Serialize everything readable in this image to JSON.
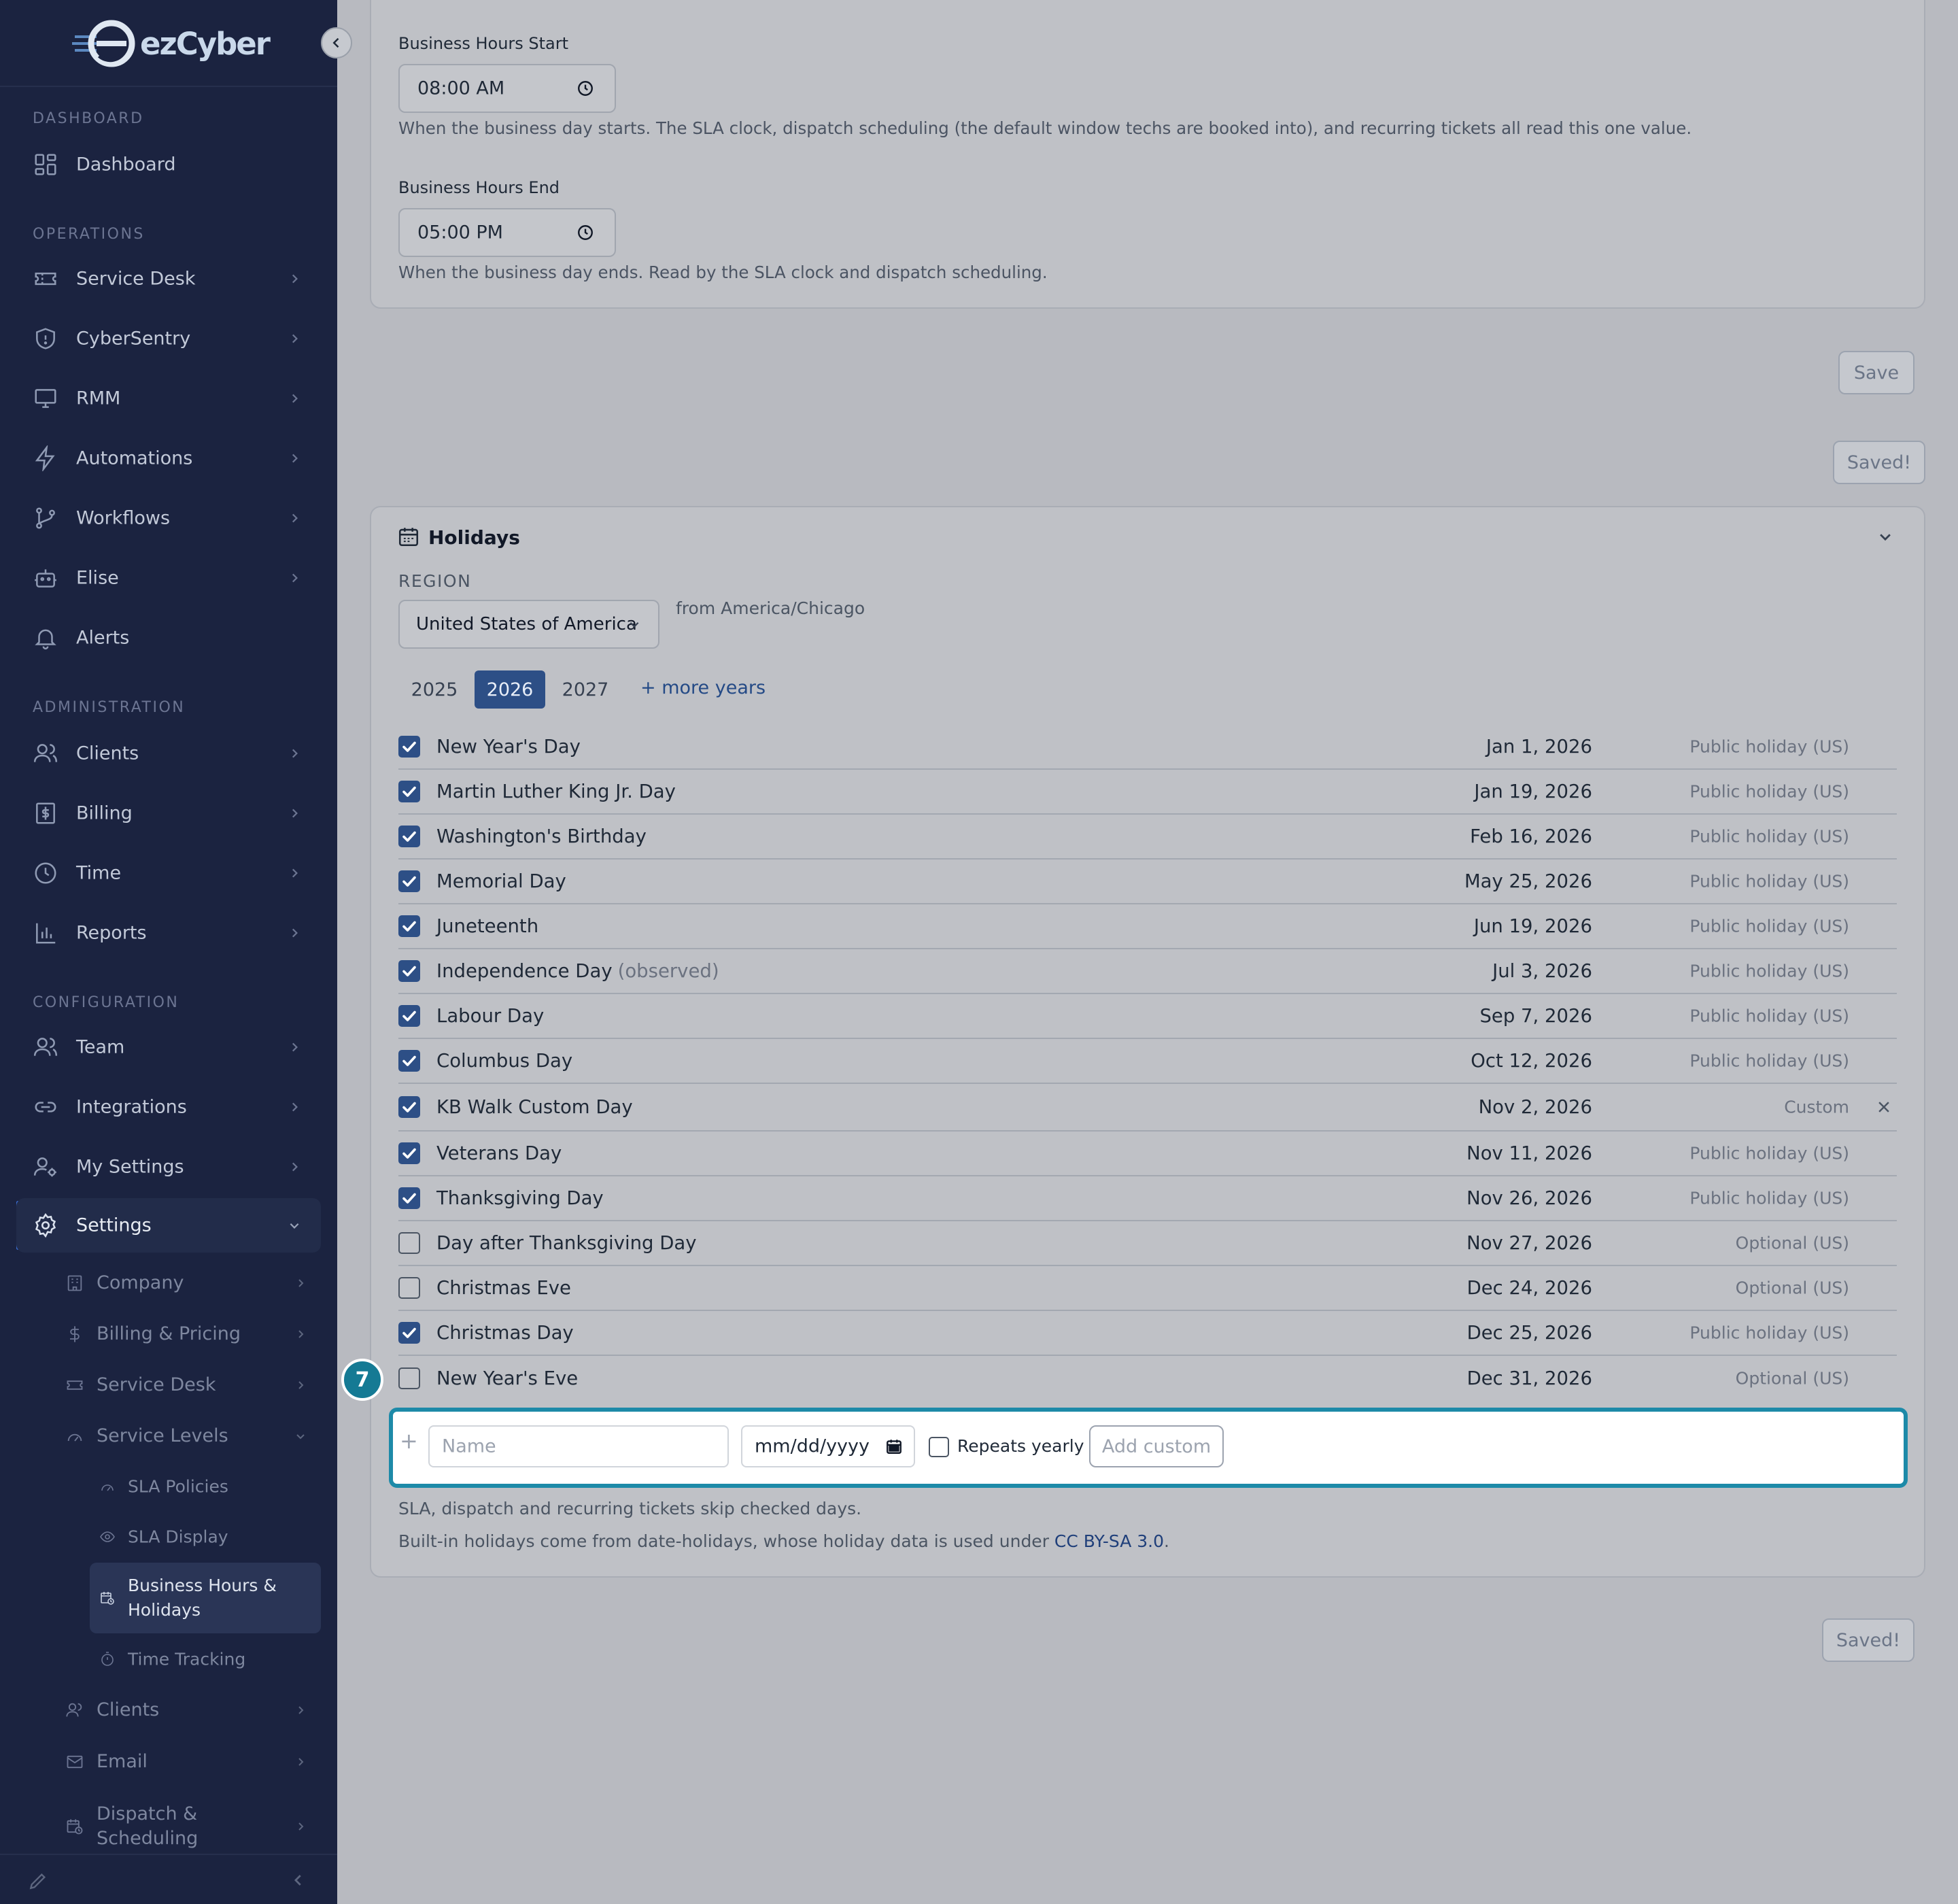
{
  "brand": {
    "name": "ezCyber"
  },
  "sidebar": {
    "sections": {
      "dashboard": "DASHBOARD",
      "operations": "OPERATIONS",
      "administration": "ADMINISTRATION",
      "configuration": "CONFIGURATION"
    },
    "items": {
      "dashboard": "Dashboard",
      "service_desk": "Service Desk",
      "cybersentry": "CyberSentry",
      "rmm": "RMM",
      "automations": "Automations",
      "workflows": "Workflows",
      "elise": "Elise",
      "alerts": "Alerts",
      "clients": "Clients",
      "billing": "Billing",
      "time": "Time",
      "reports": "Reports",
      "team": "Team",
      "integrations": "Integrations",
      "my_settings": "My Settings",
      "settings": "Settings"
    },
    "settings_sub": {
      "company": "Company",
      "billing_pricing": "Billing & Pricing",
      "service_desk": "Service Desk",
      "service_levels": "Service Levels",
      "sla_policies": "SLA Policies",
      "sla_display": "SLA Display",
      "business_hours_line1": "Business Hours &",
      "business_hours_line2": "Holidays",
      "time_tracking": "Time Tracking",
      "clients": "Clients",
      "email": "Email",
      "dispatch_line1": "Dispatch &",
      "dispatch_line2": "Scheduling"
    }
  },
  "business_hours": {
    "start_label": "Business Hours Start",
    "start_value": "08:00 AM",
    "start_help": "When the business day starts. The SLA clock, dispatch scheduling (the default window techs are booked into), and recurring tickets all read this one value.",
    "end_label": "Business Hours End",
    "end_value": "05:00 PM",
    "end_help": "When the business day ends. Read by the SLA clock and dispatch scheduling.",
    "save_label": "Save",
    "saved_label": "Saved!"
  },
  "holidays": {
    "title": "Holidays",
    "region_label": "REGION",
    "region_value": "United States of America",
    "timezone_note": "from America/Chicago",
    "years": [
      "2025",
      "2026",
      "2027"
    ],
    "selected_year": "2026",
    "more_years": "+ more years",
    "rows": [
      {
        "name": "New Year's Day",
        "suffix": "",
        "date": "Jan 1, 2026",
        "type": "Public holiday (US)",
        "checked": true
      },
      {
        "name": "Martin Luther King Jr. Day",
        "suffix": "",
        "date": "Jan 19, 2026",
        "type": "Public holiday (US)",
        "checked": true
      },
      {
        "name": "Washington's Birthday",
        "suffix": "",
        "date": "Feb 16, 2026",
        "type": "Public holiday (US)",
        "checked": true
      },
      {
        "name": "Memorial Day",
        "suffix": "",
        "date": "May 25, 2026",
        "type": "Public holiday (US)",
        "checked": true
      },
      {
        "name": "Juneteenth",
        "suffix": "",
        "date": "Jun 19, 2026",
        "type": "Public holiday (US)",
        "checked": true
      },
      {
        "name": "Independence Day",
        "suffix": "(observed)",
        "date": "Jul 3, 2026",
        "type": "Public holiday (US)",
        "checked": true
      },
      {
        "name": "Labour Day",
        "suffix": "",
        "date": "Sep 7, 2026",
        "type": "Public holiday (US)",
        "checked": true
      },
      {
        "name": "Columbus Day",
        "suffix": "",
        "date": "Oct 12, 2026",
        "type": "Public holiday (US)",
        "checked": true
      },
      {
        "name": "KB Walk Custom Day",
        "suffix": "",
        "date": "Nov 2, 2026",
        "type": "Custom",
        "checked": true
      },
      {
        "name": "Veterans Day",
        "suffix": "",
        "date": "Nov 11, 2026",
        "type": "Public holiday (US)",
        "checked": true
      },
      {
        "name": "Thanksgiving Day",
        "suffix": "",
        "date": "Nov 26, 2026",
        "type": "Public holiday (US)",
        "checked": true
      },
      {
        "name": "Day after Thanksgiving Day",
        "suffix": "",
        "date": "Nov 27, 2026",
        "type": "Optional (US)",
        "checked": false
      },
      {
        "name": "Christmas Eve",
        "suffix": "",
        "date": "Dec 24, 2026",
        "type": "Optional (US)",
        "checked": false
      },
      {
        "name": "Christmas Day",
        "suffix": "",
        "date": "Dec 25, 2026",
        "type": "Public holiday (US)",
        "checked": true
      },
      {
        "name": "New Year's Eve",
        "suffix": "",
        "date": "Dec 31, 2026",
        "type": "Optional (US)",
        "checked": false
      }
    ],
    "custom": {
      "plus": "+",
      "name_placeholder": "Name",
      "date_placeholder": "mm/dd/yyyy",
      "repeats_label": "Repeats yearly",
      "add_label": "Add custom"
    },
    "note1": "SLA, dispatch and recurring tickets skip checked days.",
    "note2_prefix": "Built-in holidays come from date-holidays, whose holiday data is used under ",
    "note2_link": "CC BY-SA 3.0",
    "note2_suffix": ".",
    "saved_label": "Saved!"
  },
  "tour": {
    "step": "7"
  }
}
